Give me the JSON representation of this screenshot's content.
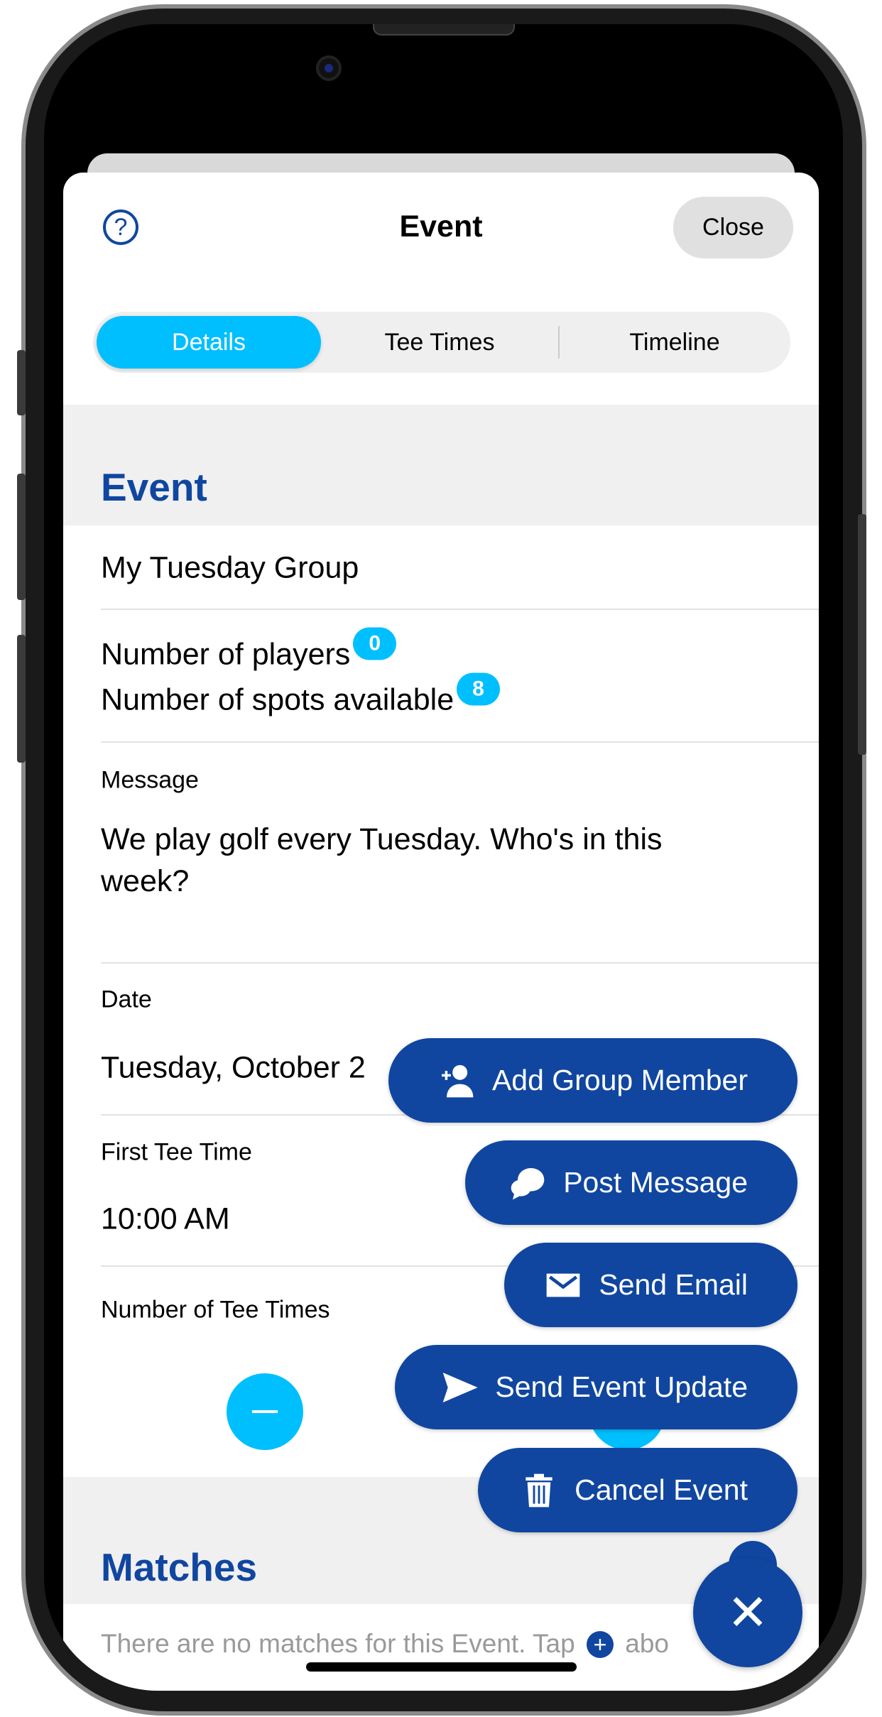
{
  "header": {
    "title": "Event",
    "close_label": "Close",
    "help_icon": "question-circle-icon"
  },
  "tabs": [
    {
      "label": "Details",
      "selected": true
    },
    {
      "label": "Tee Times",
      "selected": false
    },
    {
      "label": "Timeline",
      "selected": false
    }
  ],
  "event_section": {
    "heading": "Event",
    "name": "My Tuesday Group",
    "players_label": "Number of players",
    "players_count": "0",
    "spots_label": "Number of spots available",
    "spots_count": "8",
    "message_label": "Message",
    "message_value": "We play golf every Tuesday. Who's in this week?",
    "date_label": "Date",
    "date_value": "Tuesday, October 2",
    "first_tee_label": "First Tee Time",
    "first_tee_value": "10:00 AM",
    "tee_count_label": "Number of Tee Times"
  },
  "matches_section": {
    "heading": "Matches",
    "empty_text_start": "There are no matches for this Event. Tap",
    "empty_text_end": "abo"
  },
  "actions": [
    {
      "label": "Add Group Member",
      "icon": "add-person-icon"
    },
    {
      "label": "Post Message",
      "icon": "chat-bubbles-icon"
    },
    {
      "label": "Send Email",
      "icon": "envelope-icon"
    },
    {
      "label": "Send Event Update",
      "icon": "paper-plane-icon"
    },
    {
      "label": "Cancel Event",
      "icon": "trash-icon"
    }
  ],
  "colors": {
    "brand_blue": "#1046A0",
    "accent_cyan": "#00BFFF"
  }
}
